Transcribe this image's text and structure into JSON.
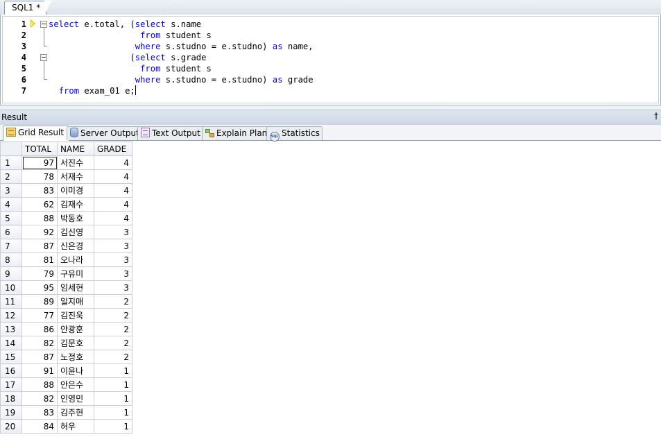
{
  "editor": {
    "tab_label": "SQL1 *",
    "lines": [
      {
        "no": "1"
      },
      {
        "no": "2"
      },
      {
        "no": "3"
      },
      {
        "no": "4"
      },
      {
        "no": "5"
      },
      {
        "no": "6"
      },
      {
        "no": "7"
      }
    ],
    "keywords": {
      "select": "select",
      "from": "from",
      "where": "where",
      "as": "as"
    },
    "text": {
      "l1a": " e.total, (",
      "l1b": " s.name",
      "l2": " student s",
      "l3a": " s.studno = e.studno) ",
      "l3b": " name,",
      "l4a": "(",
      "l4b": " s.grade",
      "l5": " student s",
      "l6a": " s.studno = e.studno) ",
      "l6b": " grade",
      "l7": " exam_01 e;"
    },
    "keyword_color": "#0000e6"
  },
  "result": {
    "title": "Result",
    "pin_glyph": "†",
    "tabs": [
      {
        "label": "Grid Result",
        "icon": "grid-icon",
        "active": true
      },
      {
        "label": "Server Output",
        "icon": "database-icon"
      },
      {
        "label": "Text Output",
        "icon": "text-output-icon"
      },
      {
        "label": "Explain Plan",
        "icon": "explain-plan-icon"
      },
      {
        "label": "Statistics",
        "icon": "statistics-icon"
      }
    ],
    "columns": [
      "TOTAL",
      "NAME",
      "GRADE"
    ],
    "rows": [
      [
        "1",
        "97",
        "서진수",
        "4"
      ],
      [
        "2",
        "78",
        "서재수",
        "4"
      ],
      [
        "3",
        "83",
        "이미경",
        "4"
      ],
      [
        "4",
        "62",
        "김재수",
        "4"
      ],
      [
        "5",
        "88",
        "박동호",
        "4"
      ],
      [
        "6",
        "92",
        "김신영",
        "3"
      ],
      [
        "7",
        "87",
        "신은경",
        "3"
      ],
      [
        "8",
        "81",
        "오나라",
        "3"
      ],
      [
        "9",
        "79",
        "구유미",
        "3"
      ],
      [
        "10",
        "95",
        "임세현",
        "3"
      ],
      [
        "11",
        "89",
        "일지매",
        "2"
      ],
      [
        "12",
        "77",
        "김진욱",
        "2"
      ],
      [
        "13",
        "86",
        "안광훈",
        "2"
      ],
      [
        "14",
        "82",
        "김문호",
        "2"
      ],
      [
        "15",
        "87",
        "노정호",
        "2"
      ],
      [
        "16",
        "91",
        "이윤나",
        "1"
      ],
      [
        "17",
        "88",
        "안은수",
        "1"
      ],
      [
        "18",
        "82",
        "인영민",
        "1"
      ],
      [
        "19",
        "83",
        "김주현",
        "1"
      ],
      [
        "20",
        "84",
        "허우",
        "1"
      ]
    ]
  }
}
